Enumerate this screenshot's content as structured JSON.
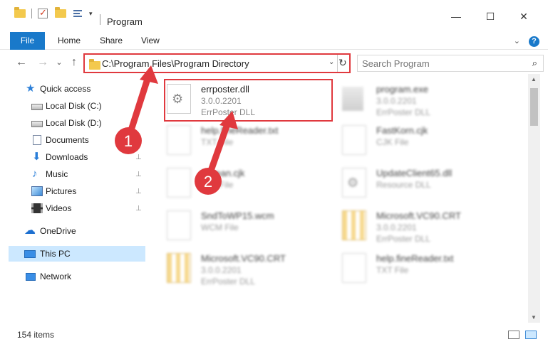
{
  "window": {
    "title": "Program",
    "controls": {
      "minimize": "—",
      "maximize": "☐",
      "close": "✕"
    }
  },
  "quick_access_toolbar": {
    "items": [
      "folder-icon",
      "checkmark-properties-icon",
      "new-folder-icon",
      "properties-icon"
    ],
    "dropdown": "▾"
  },
  "ribbon": {
    "tabs": [
      "File",
      "Home",
      "Share",
      "View"
    ],
    "expand": "⌄",
    "help": "?"
  },
  "nav": {
    "back": "←",
    "forward": "→",
    "recent": "⌄",
    "up": "↑"
  },
  "address_bar": {
    "path": "C:\\Program Files\\Program Directory",
    "dropdown": "⌄",
    "refresh": "↻"
  },
  "search": {
    "placeholder": "Search Program",
    "icon": "⌕"
  },
  "sidebar": {
    "items": [
      {
        "label": "Quick access",
        "icon": "star-icon"
      },
      {
        "label": "Local Disk (C:)",
        "icon": "disk-icon"
      },
      {
        "label": "Local Disk (D:)",
        "icon": "disk-icon"
      },
      {
        "label": "Documents",
        "icon": "documents-icon"
      },
      {
        "label": "Downloads",
        "icon": "download-icon"
      },
      {
        "label": "Music",
        "icon": "music-icon"
      },
      {
        "label": "Pictures",
        "icon": "pictures-icon"
      },
      {
        "label": "Videos",
        "icon": "videos-icon"
      },
      {
        "label": "OneDrive",
        "icon": "cloud-icon"
      },
      {
        "label": "This PC",
        "icon": "computer-icon"
      },
      {
        "label": "Network",
        "icon": "network-icon"
      }
    ],
    "pin_glyph": "📌",
    "selected": "This PC"
  },
  "files": [
    {
      "name": "errposter.dll",
      "line2": "3.0.0.2201",
      "line3": "ErrPoster DLL",
      "icon": "dll-gear-icon"
    },
    {
      "name": "program.exe",
      "line2": "3.0.0.2201",
      "line3": "ErrPoster DLL",
      "icon": "exe-icon"
    },
    {
      "name": "help.fineReader.txt",
      "line2": "TXT File",
      "icon": "text-file-icon"
    },
    {
      "name": "FastKorn.cjk",
      "line2": "CJK File",
      "icon": "blank-file-icon"
    },
    {
      "name": "Korean.cjk",
      "line2": "CJK File",
      "icon": "blank-file-icon"
    },
    {
      "name": "UpdateClient65.dll",
      "line2": "Resource DLL",
      "icon": "dll-gear-icon"
    },
    {
      "name": "SndToWP15.wcm",
      "line2": "WCM File",
      "icon": "blank-file-icon"
    },
    {
      "name": "Microsoft.VC90.CRT",
      "line2": "3.0.0.2201",
      "line3": "ErrPoster DLL",
      "icon": "zip-icon"
    },
    {
      "name": "Microsoft.VC90.CRT",
      "line2": "3.0.0.2201",
      "line3": "ErrPoster DLL",
      "icon": "zip-icon"
    },
    {
      "name": "help.fineReader.txt",
      "line2": "TXT File",
      "icon": "text-file-icon"
    }
  ],
  "annotations": {
    "step1": "1",
    "step2": "2",
    "color": "#e0393e"
  },
  "statusbar": {
    "count": "154 items"
  }
}
